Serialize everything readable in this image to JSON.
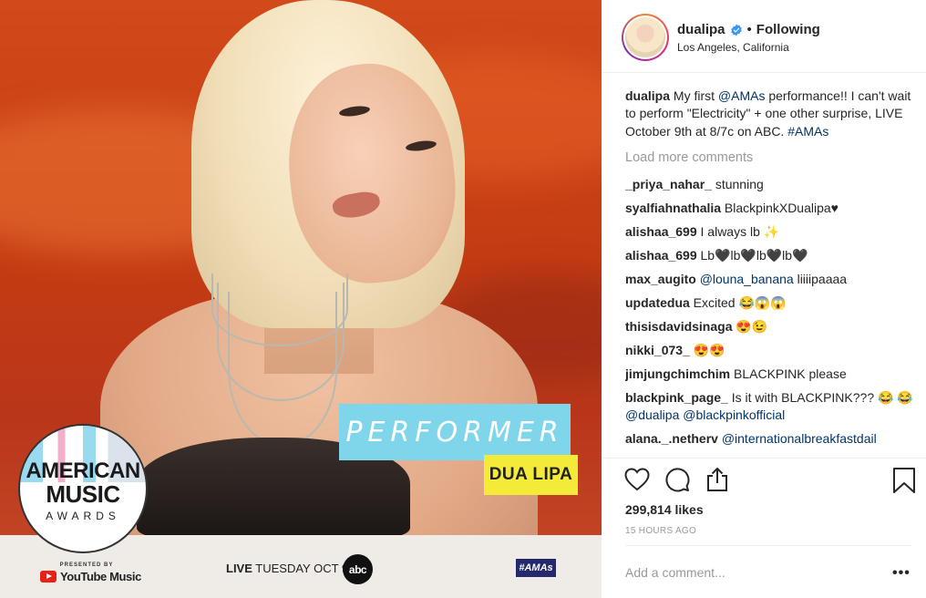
{
  "post_image": {
    "banner_role": "PERFORMER",
    "banner_name": "DUA LIPA",
    "logo_line1": "AMERICAN",
    "logo_line2": "MUSIC",
    "logo_line3": "AWARDS",
    "presented_by": "PRESENTED BY",
    "sponsor": "YouTube Music",
    "live_prefix": "LIVE",
    "live_date": "TUESDAY OCT 9",
    "network": "abc",
    "hashtag_badge": "#AMAs"
  },
  "header": {
    "username": "dualipa",
    "separator": "•",
    "follow_state": "Following",
    "location": "Los Angeles, California"
  },
  "caption": {
    "username": "dualipa",
    "text_1": " My first ",
    "mention": "@AMAs",
    "text_2": " performance!! I can't wait to perform \"Electricity\" + one other surprise, LIVE October 9th at 8/7c on ABC. ",
    "hashtag": "#AMAs"
  },
  "load_more": "Load more comments",
  "comments": [
    {
      "user": "_priya_nahar_",
      "text": " stunning"
    },
    {
      "user": "syalfiahnathalia",
      "text": " BlackpinkXDualipa♥"
    },
    {
      "user": "alishaa_699",
      "text": " I always lb ✨"
    },
    {
      "user": "alishaa_699",
      "text": " Lb🖤lb🖤lb🖤lb🖤"
    },
    {
      "user": "max_augito",
      "mention": "@louna_banana",
      "text": " liiiipaaaa"
    },
    {
      "user": "updatedua",
      "text": " Excited 😂😱😱"
    },
    {
      "user": "thisisdavidsinaga",
      "text": " 😍😉"
    },
    {
      "user": "nikki_073_",
      "text": " 😍😍"
    },
    {
      "user": "jimjungchimchim",
      "text": " BLACKPINK please"
    },
    {
      "user": "blackpink_page_",
      "text": " Is it with BLACKPINK??? 😂 😂 ",
      "mention": "@dualipa",
      "mention2": "@blackpinkofficial"
    },
    {
      "user": "alana._.netherv",
      "mention": "@internationalbreakfastdail"
    }
  ],
  "actions": {
    "like": "heart-icon",
    "comment": "comment-icon",
    "share": "share-icon",
    "save": "bookmark-icon"
  },
  "likes": "299,814 likes",
  "time": "15 HOURS AGO",
  "add_comment_placeholder": "Add a comment...",
  "more": "•••",
  "colors": {
    "link": "#003569",
    "verified": "#3897f0",
    "muted": "#999999",
    "banner_blue": "#7fd6ea",
    "banner_yellow": "#f4ea3a"
  }
}
